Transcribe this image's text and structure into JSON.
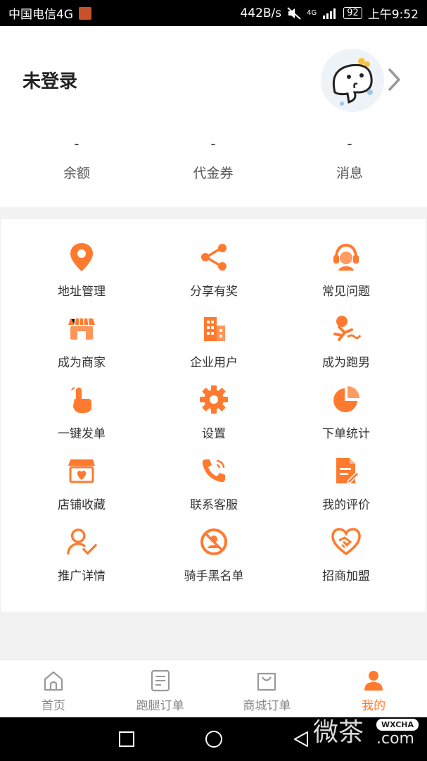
{
  "status_bar": {
    "carrier": "中国电信4G",
    "speed": "442B/s",
    "network": "4G",
    "battery": "92",
    "time": "上午9:52"
  },
  "profile": {
    "title": "未登录",
    "stats": [
      {
        "value": "-",
        "label": "余额"
      },
      {
        "value": "-",
        "label": "代金券"
      },
      {
        "value": "-",
        "label": "消息"
      }
    ]
  },
  "menu": {
    "accent": "#ff7a2f",
    "items": [
      {
        "label": "地址管理",
        "icon": "location-pin-icon"
      },
      {
        "label": "分享有奖",
        "icon": "share-icon"
      },
      {
        "label": "常见问题",
        "icon": "customer-service-icon"
      },
      {
        "label": "成为商家",
        "icon": "storefront-icon"
      },
      {
        "label": "企业用户",
        "icon": "building-icon"
      },
      {
        "label": "成为跑男",
        "icon": "runner-icon"
      },
      {
        "label": "一键发单",
        "icon": "tap-hand-icon"
      },
      {
        "label": "设置",
        "icon": "gear-icon"
      },
      {
        "label": "下单统计",
        "icon": "pie-chart-icon"
      },
      {
        "label": "店铺收藏",
        "icon": "store-heart-icon"
      },
      {
        "label": "联系客服",
        "icon": "phone-icon"
      },
      {
        "label": "我的评价",
        "icon": "document-edit-icon"
      },
      {
        "label": "推广详情",
        "icon": "user-check-icon"
      },
      {
        "label": "骑手黑名单",
        "icon": "blocked-user-icon"
      },
      {
        "label": "招商加盟",
        "icon": "handshake-icon"
      }
    ]
  },
  "tabbar": {
    "tabs": [
      {
        "label": "首页",
        "icon": "home-icon"
      },
      {
        "label": "跑腿订单",
        "icon": "order-list-icon"
      },
      {
        "label": "商城订单",
        "icon": "shopping-bag-icon"
      },
      {
        "label": "我的",
        "icon": "person-icon"
      }
    ],
    "active_index": 3
  },
  "watermark": {
    "text": "微茶",
    "badge": "WXCHA",
    "suffix": ".com"
  }
}
